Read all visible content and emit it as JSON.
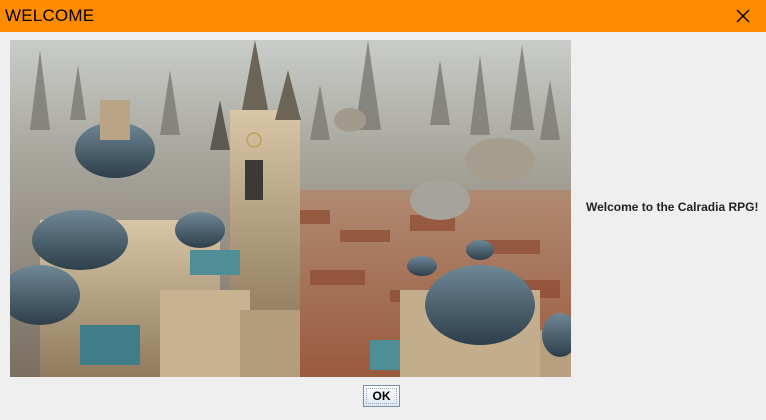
{
  "window": {
    "title": "WELCOME",
    "titlebar_color": "#ff8c00"
  },
  "close_icon": "close-icon",
  "image": {
    "subject": "fantasy city with spires and domes"
  },
  "message": "Welcome to the Calradia RPG!",
  "ok_button": {
    "label": "OK"
  }
}
